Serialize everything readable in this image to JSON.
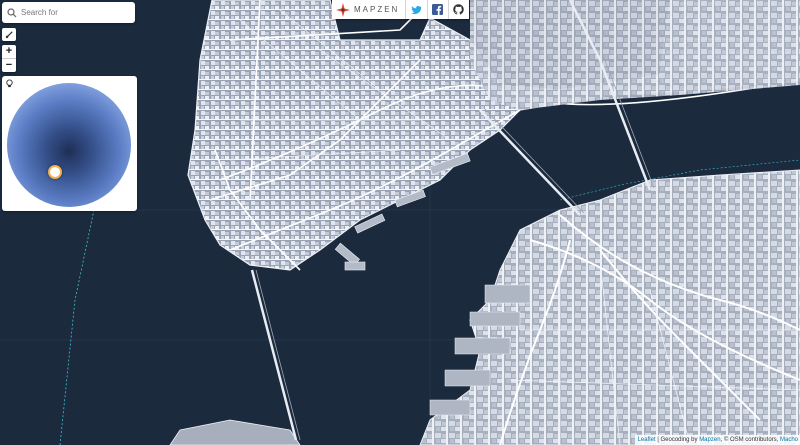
{
  "search": {
    "placeholder": "Search for"
  },
  "zoom": {
    "in_label": "+",
    "out_label": "−"
  },
  "topbar": {
    "brand_name": "MAPZEN",
    "icons": [
      "mapzen-logo-icon",
      "twitter-icon",
      "facebook-icon",
      "github-icon"
    ]
  },
  "attribution": {
    "leaflet": "Leaflet",
    "geocoding_prefix": " | Geocoding by ",
    "mapzen": "Mapzen",
    "osm": ", © OSM contributors, ",
    "macho": "Macho"
  },
  "colors": {
    "water": "#1b2a3d",
    "land": "#8e97a6",
    "buildings": "#c7cedd",
    "roads": "#ffffff",
    "accent": "#3c8bd0",
    "light_handle": "#f3b04a"
  }
}
